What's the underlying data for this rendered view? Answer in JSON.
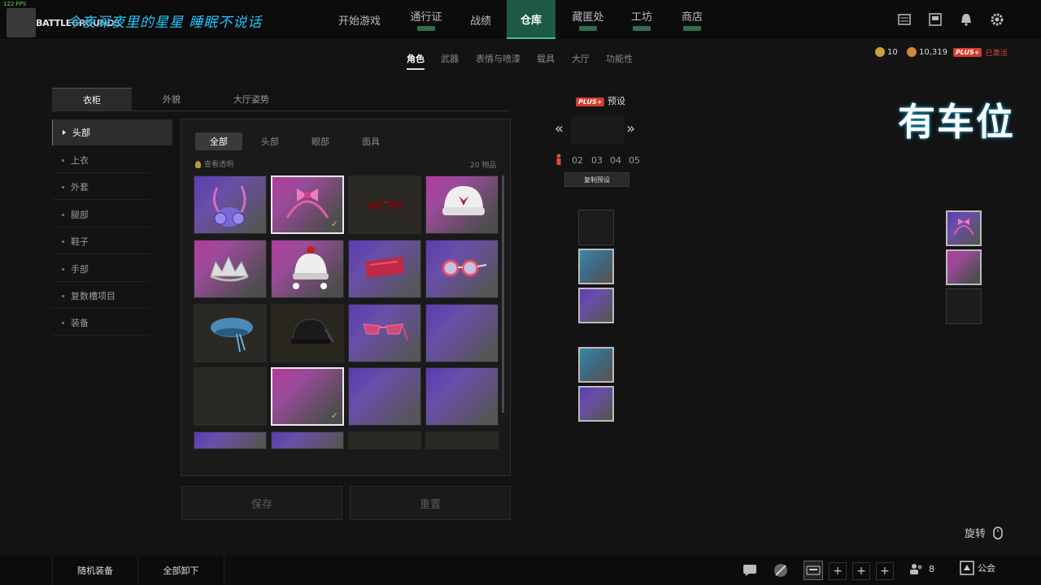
{
  "topbar": {
    "fps": "122 FPS",
    "logo": "BATTLEGROUNDS",
    "streamer": "今夜深夜里的星星 睡眠不说话",
    "nav": [
      {
        "label": "开始游戏",
        "badge": false
      },
      {
        "label": "通行证",
        "badge": true
      },
      {
        "label": "战绩",
        "badge": false
      },
      {
        "label": "仓库",
        "badge": false,
        "active": true
      },
      {
        "label": "藏匿处",
        "badge": true
      },
      {
        "label": "工坊",
        "badge": true
      },
      {
        "label": "商店",
        "badge": true
      }
    ],
    "icons": [
      "list-icon",
      "mail-icon",
      "bell-icon",
      "gear-icon"
    ]
  },
  "subtabs": [
    "角色",
    "武器",
    "表情与喷漆",
    "载具",
    "大厅",
    "功能性"
  ],
  "currency": {
    "coins": "10",
    "bp": "10,319",
    "plus_label": "PLUS+",
    "plus_status": "已激活"
  },
  "wardrobe": {
    "tabs": [
      "衣柜",
      "外貌",
      "大厅姿势"
    ],
    "categories": [
      "头部",
      "上衣",
      "外套",
      "腿部",
      "鞋子",
      "手部",
      "复数槽项目",
      "装备"
    ],
    "filters": [
      "全部",
      "头部",
      "眼部",
      "面具"
    ],
    "view_transparent": "查看透明",
    "item_count": "20 物品",
    "items": [
      {
        "name": "purple-gas-mask",
        "bg": "purple",
        "selected": false
      },
      {
        "name": "pink-bow-headband",
        "bg": "pink",
        "selected": true
      },
      {
        "name": "red-sunglasses",
        "bg": "dark",
        "selected": false
      },
      {
        "name": "white-beanie",
        "bg": "pink",
        "selected": false
      },
      {
        "name": "silver-tiara",
        "bg": "pink",
        "selected": false
      },
      {
        "name": "white-bobble-hat",
        "bg": "pink",
        "selected": false
      },
      {
        "name": "red-eye-mask",
        "bg": "purple",
        "selected": false
      },
      {
        "name": "round-glasses",
        "bg": "purple",
        "selected": false
      },
      {
        "name": "blue-beret",
        "bg": "dark",
        "selected": false
      },
      {
        "name": "black-helmet",
        "bg": "dark",
        "selected": false
      },
      {
        "name": "pink-cat-glasses",
        "bg": "purple",
        "selected": false
      },
      {
        "name": "empty-purple-1",
        "bg": "purple",
        "selected": false
      },
      {
        "name": "empty-dark",
        "bg": "dark",
        "selected": false
      },
      {
        "name": "empty-pink-selected",
        "bg": "pink",
        "selected": true
      },
      {
        "name": "empty-purple-2",
        "bg": "purple",
        "selected": false
      },
      {
        "name": "empty-purple-3",
        "bg": "purple",
        "selected": false
      },
      {
        "name": "partial-purple-1",
        "bg": "purple",
        "selected": false
      },
      {
        "name": "partial-purple-2",
        "bg": "purple",
        "selected": false
      },
      {
        "name": "partial-dark-1",
        "bg": "dark",
        "selected": false
      },
      {
        "name": "partial-dark-2",
        "bg": "dark",
        "selected": false
      }
    ],
    "save_label": "保存",
    "reset_label": "重置"
  },
  "preset": {
    "badge": "PLUS+",
    "title": "预设",
    "numbers": [
      "02",
      "03",
      "04",
      "05"
    ],
    "copy_label": "复制预设"
  },
  "watermark": "有车位",
  "rotate_label": "旋转",
  "bottombar": {
    "random_label": "随机装备",
    "unequip_label": "全部卸下",
    "friends_count": "8",
    "guild_label": "公会"
  }
}
